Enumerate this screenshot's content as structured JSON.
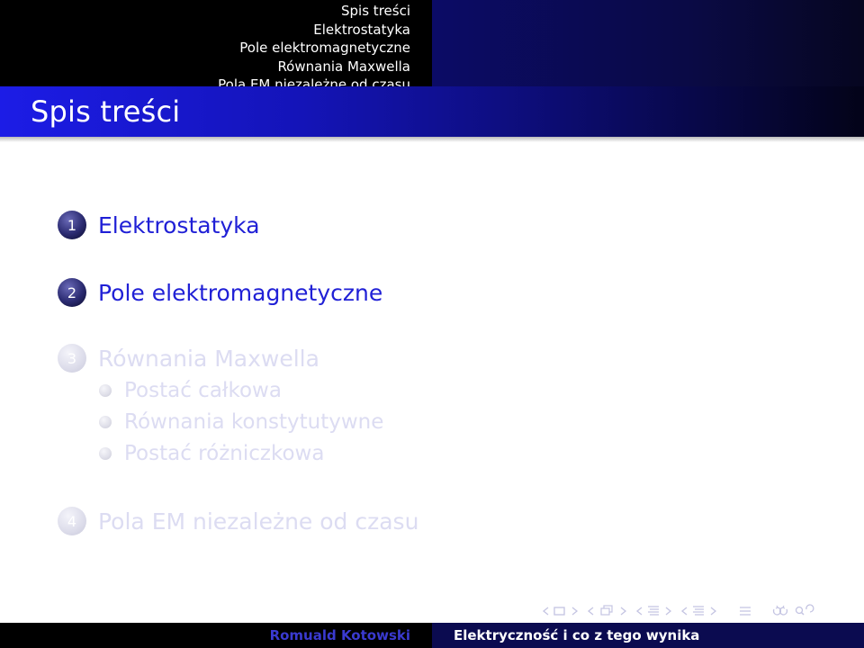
{
  "nav": {
    "items": [
      {
        "label": "Spis treści",
        "current": true
      },
      {
        "label": "Elektrostatyka",
        "current": false
      },
      {
        "label": "Pole elektromagnetyczne",
        "current": false
      },
      {
        "label": "Równania Maxwella",
        "current": false
      },
      {
        "label": "Pola EM niezależne od czasu",
        "current": false
      }
    ]
  },
  "frame": {
    "title": "Spis treści"
  },
  "toc": {
    "sections": [
      {
        "number": "1",
        "label": "Elektrostatyka",
        "faded": false
      },
      {
        "number": "2",
        "label": "Pole elektromagnetyczne",
        "faded": false
      },
      {
        "number": "3",
        "label": "Równania Maxwella",
        "faded": true,
        "subsections": [
          "Postać całkowa",
          "Równania konstytutywne",
          "Postać różniczkowa"
        ]
      },
      {
        "number": "4",
        "label": "Pola EM niezależne od czasu",
        "faded": true
      }
    ]
  },
  "footer": {
    "author": "Romuald Kotowski",
    "title": "Elektryczność i co z tego wynika"
  },
  "colors": {
    "accent": "#2020d6",
    "faded_text": "#dcdcf2",
    "title_bar": "#1c1ce6",
    "nav_dim": "#8a8ad6"
  },
  "icons": {
    "nav_symbols": [
      "frame-prev-icon",
      "frame-icon",
      "frame-next-icon",
      "subsection-prev-icon",
      "subsection-icon",
      "subsection-next-icon",
      "section-prev-icon",
      "section-icon",
      "section-next-icon",
      "align-icon",
      "back-forward-search-icon"
    ]
  }
}
